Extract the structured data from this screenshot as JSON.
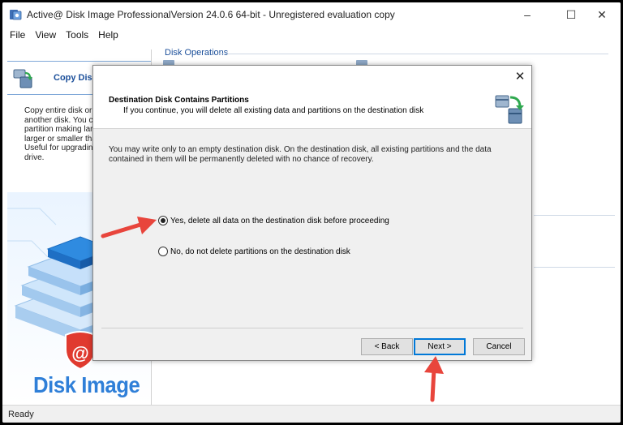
{
  "window": {
    "title": "Active@ Disk Image ProfessionalVersion 24.0.6 64-bit   - Unregistered evaluation copy",
    "minimize": "–",
    "maximize": "☐",
    "close": "✕"
  },
  "menu": [
    "File",
    "View",
    "Tools",
    "Help"
  ],
  "left_panel": {
    "title": "Copy Disk",
    "description_lines": [
      "Copy entire disk or p",
      "another disk. You ca",
      "partition making larg",
      "larger or smaller tha",
      "Useful for upgrading",
      "drive."
    ],
    "brand": "Disk Image"
  },
  "main": {
    "section_title": "Disk Operations"
  },
  "status": {
    "text": "Ready"
  },
  "dialog": {
    "close": "✕",
    "title": "Destination Disk Contains Partitions",
    "subtitle": "If you continue, you will delete all existing data and partitions on the destination disk",
    "body_lines": [
      "You may write only to an empty destination disk. On the destination disk, all existing partitions and the data",
      "contained in them will be permanently deleted with no chance of recovery."
    ],
    "options": [
      {
        "label": "Yes, delete all data on the destination disk before proceeding",
        "checked": true
      },
      {
        "label": "No, do not delete partitions on the destination disk",
        "checked": false
      }
    ],
    "buttons": {
      "back": "< Back",
      "next": "Next >",
      "cancel": "Cancel"
    }
  },
  "colors": {
    "accent": "#0078d7",
    "brand_blue": "#2f7fd8",
    "header_blue": "#1b4f9a",
    "arrow_red": "#e8453c"
  }
}
